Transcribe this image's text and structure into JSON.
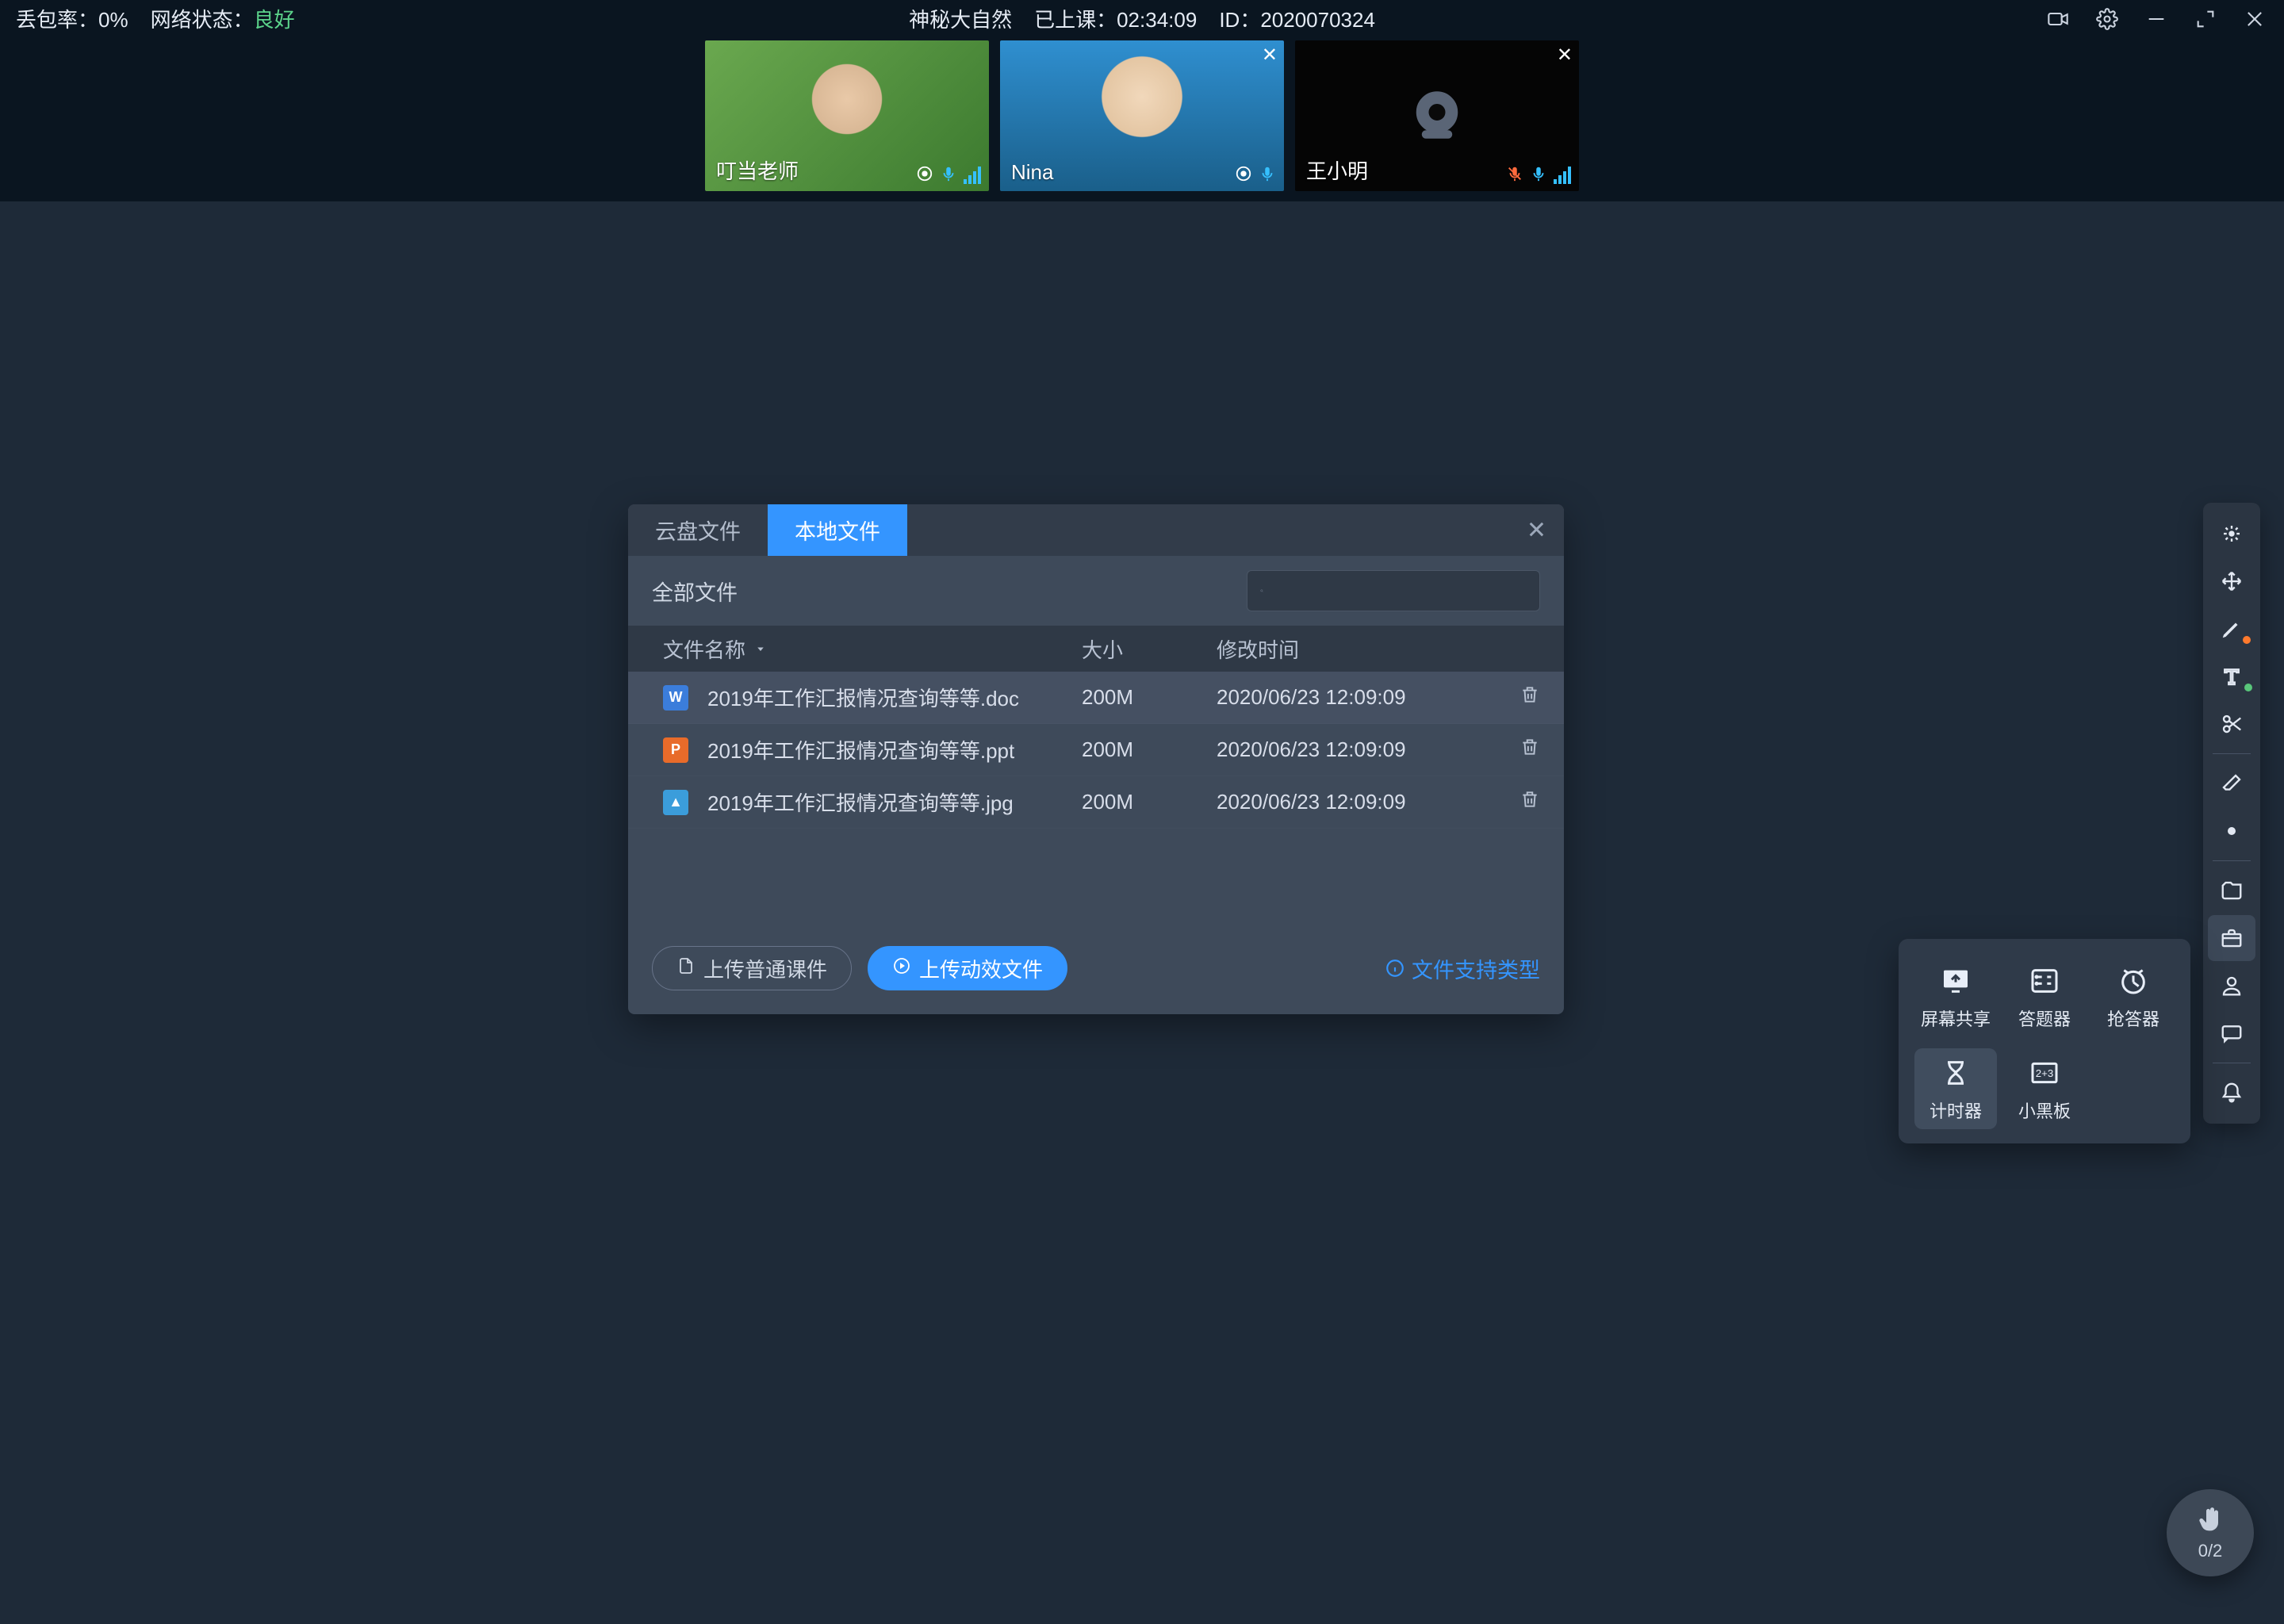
{
  "status": {
    "packet_loss_label": "丢包率：",
    "packet_loss_value": "0%",
    "net_label": "网络状态：",
    "net_value": "良好",
    "title": "神秘大自然",
    "elapsed_label": "已上课：",
    "elapsed_value": "02:34:09",
    "id_label": "ID：",
    "id_value": "2020070324"
  },
  "participants": [
    {
      "name": "叮当老师",
      "mic_muted": false,
      "show_close": false,
      "camera_off": false
    },
    {
      "name": "Nina",
      "mic_muted": false,
      "show_close": true,
      "camera_off": false
    },
    {
      "name": "王小明",
      "mic_muted": true,
      "show_close": true,
      "camera_off": true
    }
  ],
  "file_dialog": {
    "tabs": {
      "cloud": "云盘文件",
      "local": "本地文件"
    },
    "filter_label": "全部文件",
    "search_placeholder": "",
    "columns": {
      "name": "文件名称",
      "size": "大小",
      "time": "修改时间"
    },
    "files": [
      {
        "name": "2019年工作汇报情况查询等等.doc",
        "size": "200M",
        "time": "2020/06/23 12:09:09",
        "type": "doc"
      },
      {
        "name": "2019年工作汇报情况查询等等.ppt",
        "size": "200M",
        "time": "2020/06/23 12:09:09",
        "type": "ppt"
      },
      {
        "name": "2019年工作汇报情况查询等等.jpg",
        "size": "200M",
        "time": "2020/06/23 12:09:09",
        "type": "jpg"
      }
    ],
    "upload_normal": "上传普通课件",
    "upload_effect": "上传动效文件",
    "support_link": "文件支持类型"
  },
  "tools_popover": {
    "screen_share": "屏幕共享",
    "answerer": "答题器",
    "buzzer": "抢答器",
    "timer": "计时器",
    "blackboard": "小黑板"
  },
  "hand": {
    "count": "0/2"
  }
}
